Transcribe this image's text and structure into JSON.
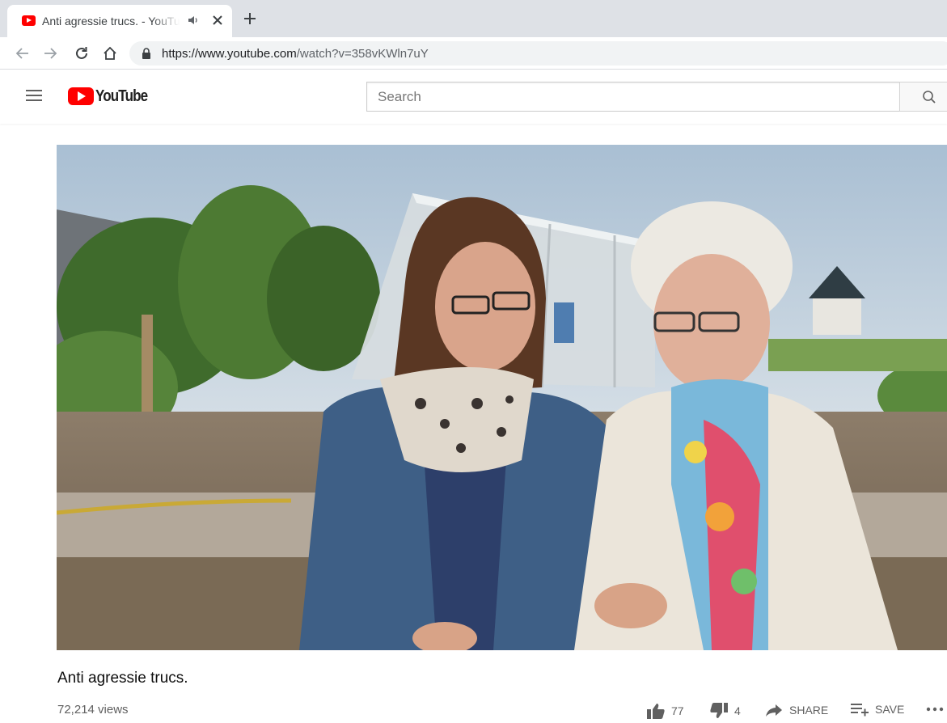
{
  "browser": {
    "tab_title": "Anti agressie trucs. - YouTube",
    "url_host": "https://www.youtube.com",
    "url_path": "/watch?v=358vKWln7uY"
  },
  "masthead": {
    "logo_text": "YouTube",
    "search_placeholder": "Search"
  },
  "video": {
    "title": "Anti agressie trucs.",
    "views": "72,214 views",
    "likes": "77",
    "dislikes": "4",
    "share_label": "SHARE",
    "save_label": "SAVE"
  },
  "colors": {
    "brand": "#ff0000",
    "tabstrip": "#dee1e6",
    "omnibox": "#f1f3f4"
  },
  "icons": [
    "youtube-favicon",
    "audio-icon",
    "close-icon",
    "plus-icon",
    "back-arrow-icon",
    "forward-arrow-icon",
    "reload-icon",
    "home-icon",
    "lock-icon",
    "hamburger-menu-icon",
    "search-icon",
    "thumbs-up-icon",
    "thumbs-down-icon",
    "share-icon",
    "save-playlist-icon",
    "more-icon"
  ]
}
